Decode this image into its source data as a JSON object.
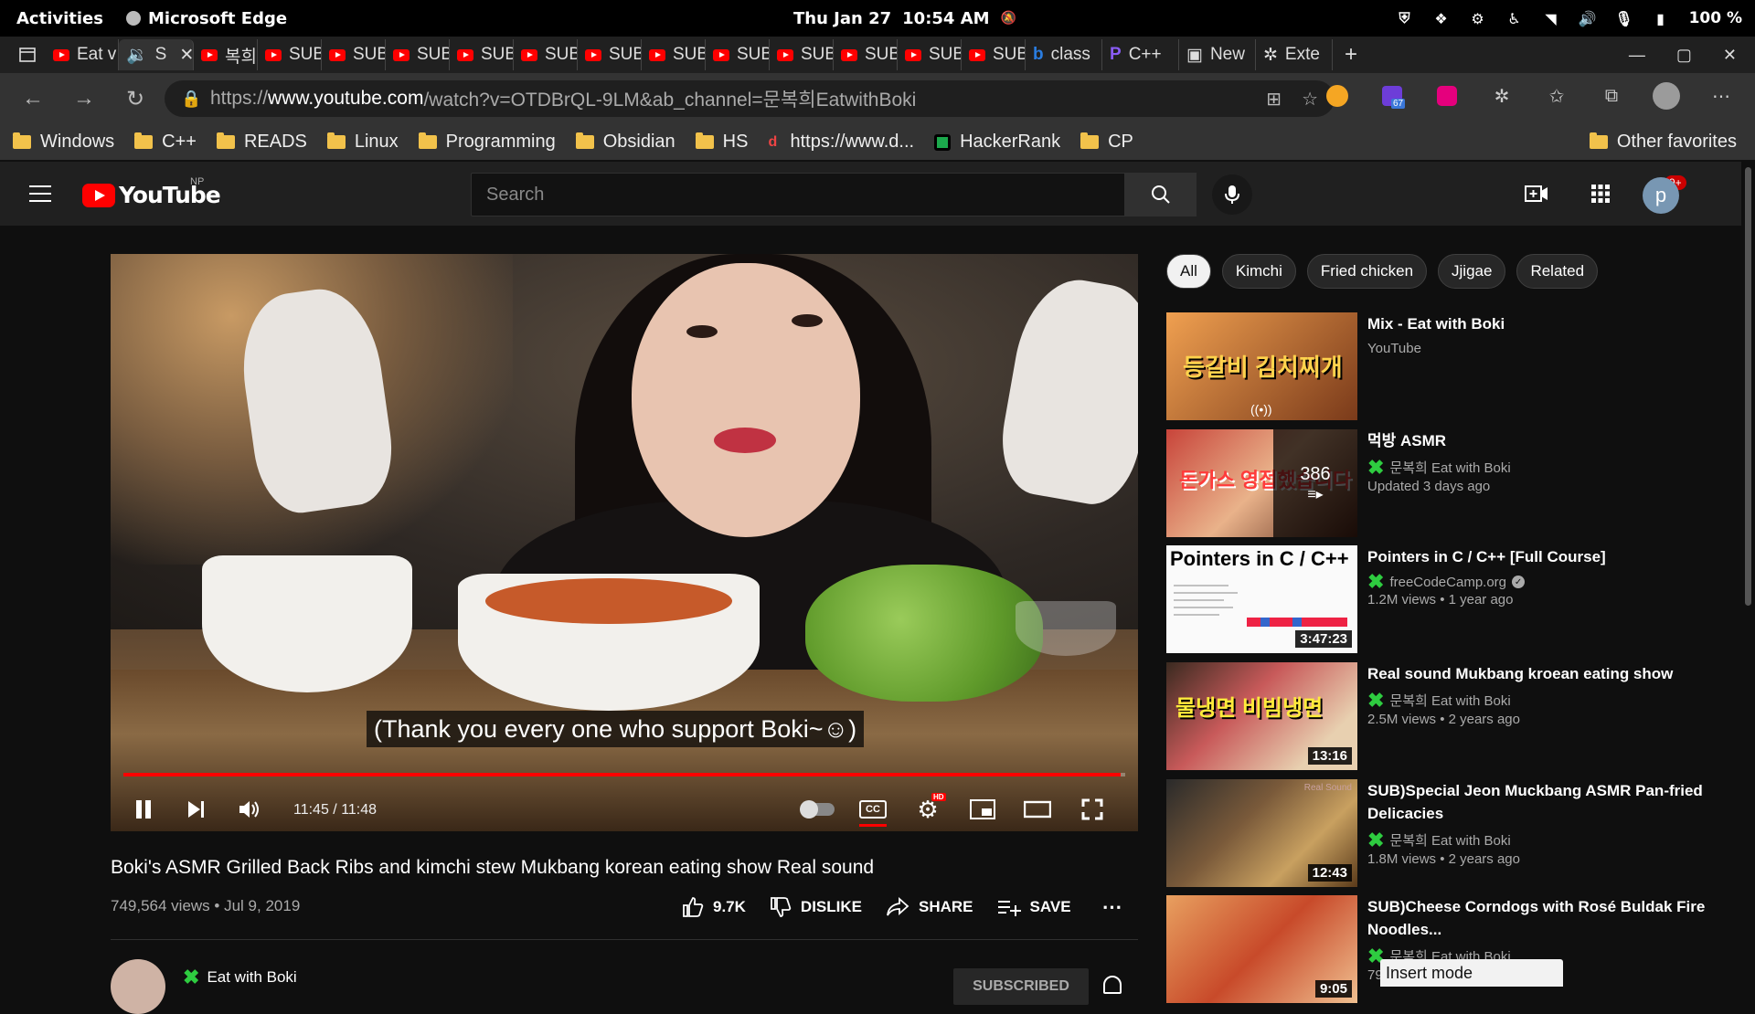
{
  "system": {
    "activities": "Activities",
    "app_name": "Microsoft Edge",
    "date": "Thu Jan 27",
    "time": "10:54 AM",
    "battery": "100 %"
  },
  "tabs": [
    {
      "label": "Eat v",
      "favicon": "youtube-icon",
      "active": false
    },
    {
      "label": "S",
      "favicon": "speaker-icon",
      "active": true
    },
    {
      "label": "복희",
      "favicon": "youtube-icon"
    },
    {
      "label": "SUB",
      "favicon": "youtube-icon"
    },
    {
      "label": "SUB",
      "favicon": "youtube-icon"
    },
    {
      "label": "SUB",
      "favicon": "youtube-icon"
    },
    {
      "label": "SUB",
      "favicon": "youtube-icon"
    },
    {
      "label": "SUB",
      "favicon": "youtube-icon"
    },
    {
      "label": "SUB",
      "favicon": "youtube-icon"
    },
    {
      "label": "SUB",
      "favicon": "youtube-icon"
    },
    {
      "label": "SUB",
      "favicon": "youtube-icon"
    },
    {
      "label": "SUB",
      "favicon": "youtube-icon"
    },
    {
      "label": "SUB",
      "favicon": "youtube-icon"
    },
    {
      "label": "SUB",
      "favicon": "youtube-icon"
    },
    {
      "label": "SUB",
      "favicon": "youtube-icon"
    },
    {
      "label": "class",
      "favicon": "bing-icon"
    },
    {
      "label": "C++",
      "favicon": "generic-icon"
    },
    {
      "label": "New",
      "favicon": "new-tab-icon"
    },
    {
      "label": "Exte",
      "favicon": "extension-icon"
    }
  ],
  "address": {
    "prefix": "https://",
    "domain": "www.youtube.com",
    "path": "/watch?v=OTDBrQL-9LM&ab_channel=문복희EatwithBoki",
    "extension_badge": "67"
  },
  "bookmarks": [
    {
      "label": "Windows",
      "icon": "folder-icon"
    },
    {
      "label": "C++",
      "icon": "folder-icon"
    },
    {
      "label": "READS",
      "icon": "folder-icon"
    },
    {
      "label": "Linux",
      "icon": "folder-icon"
    },
    {
      "label": "Programming",
      "icon": "folder-icon"
    },
    {
      "label": "Obsidian",
      "icon": "folder-icon"
    },
    {
      "label": "HS",
      "icon": "folder-icon"
    },
    {
      "label": "https://www.d...",
      "icon": "link-icon"
    },
    {
      "label": "HackerRank",
      "icon": "hackerrank-icon"
    },
    {
      "label": "CP",
      "icon": "folder-icon"
    }
  ],
  "other_favorites": "Other favorites",
  "youtube": {
    "logo_text": "YouTube",
    "region": "NP",
    "search_placeholder": "Search",
    "notifications": "9+",
    "avatar_letter": "p"
  },
  "player": {
    "subtitle": "(Thank you every one who support Boki~☺)",
    "time": "11:45 / 11:48",
    "progress": 0.9957,
    "cc": "CC",
    "hd": "HD"
  },
  "video": {
    "title": "Boki's ASMR Grilled Back Ribs and kimchi stew Mukbang korean eating show Real sound",
    "views": "749,564 views",
    "date": "Jul 9, 2019",
    "likes": "9.7K",
    "dislike": "DISLIKE",
    "share": "SHARE",
    "save": "SAVE",
    "channel": "Eat with Boki",
    "subscribed": "SUBSCRIBED"
  },
  "chips": [
    "All",
    "Kimchi",
    "Fried chicken",
    "Jjigae",
    "Related"
  ],
  "recommended": [
    {
      "title": "Mix - Eat with Boki",
      "channel": "YouTube",
      "meta": "",
      "duration": "",
      "thumb_text": "등갈비 김치찌개"
    },
    {
      "title": "먹방 ASMR",
      "channel": "문복희 Eat with Boki",
      "meta": "Updated 3 days ago",
      "duration": "",
      "thumb_text": "돈가스 영접했습니다",
      "playlist_count": "386"
    },
    {
      "title": "Pointers in C / C++ [Full Course]",
      "channel": "freeCodeCamp.org",
      "meta": "1.2M views • 1 year ago",
      "duration": "3:47:23",
      "thumb_text": "Pointers in C / C++"
    },
    {
      "title": "Real sound Mukbang kroean eating show",
      "channel": "문복희 Eat with Boki",
      "meta": "2.5M views • 2 years ago",
      "duration": "13:16",
      "thumb_text": "물냉면 비빔냉면"
    },
    {
      "title": "SUB)Special Jeon Muckbang ASMR Pan-fried Delicacies",
      "channel": "문복희 Eat with Boki",
      "meta": "1.8M views • 2 years ago",
      "duration": "12:43",
      "thumb_text": "Real Sound"
    },
    {
      "title": "SUB)Cheese Corndogs with Rosé Buldak Fire Noodles...",
      "channel": "문복희 Eat with Boki",
      "meta": "79",
      "duration": "9:05",
      "thumb_text": ""
    }
  ],
  "vim_status": "Insert mode"
}
